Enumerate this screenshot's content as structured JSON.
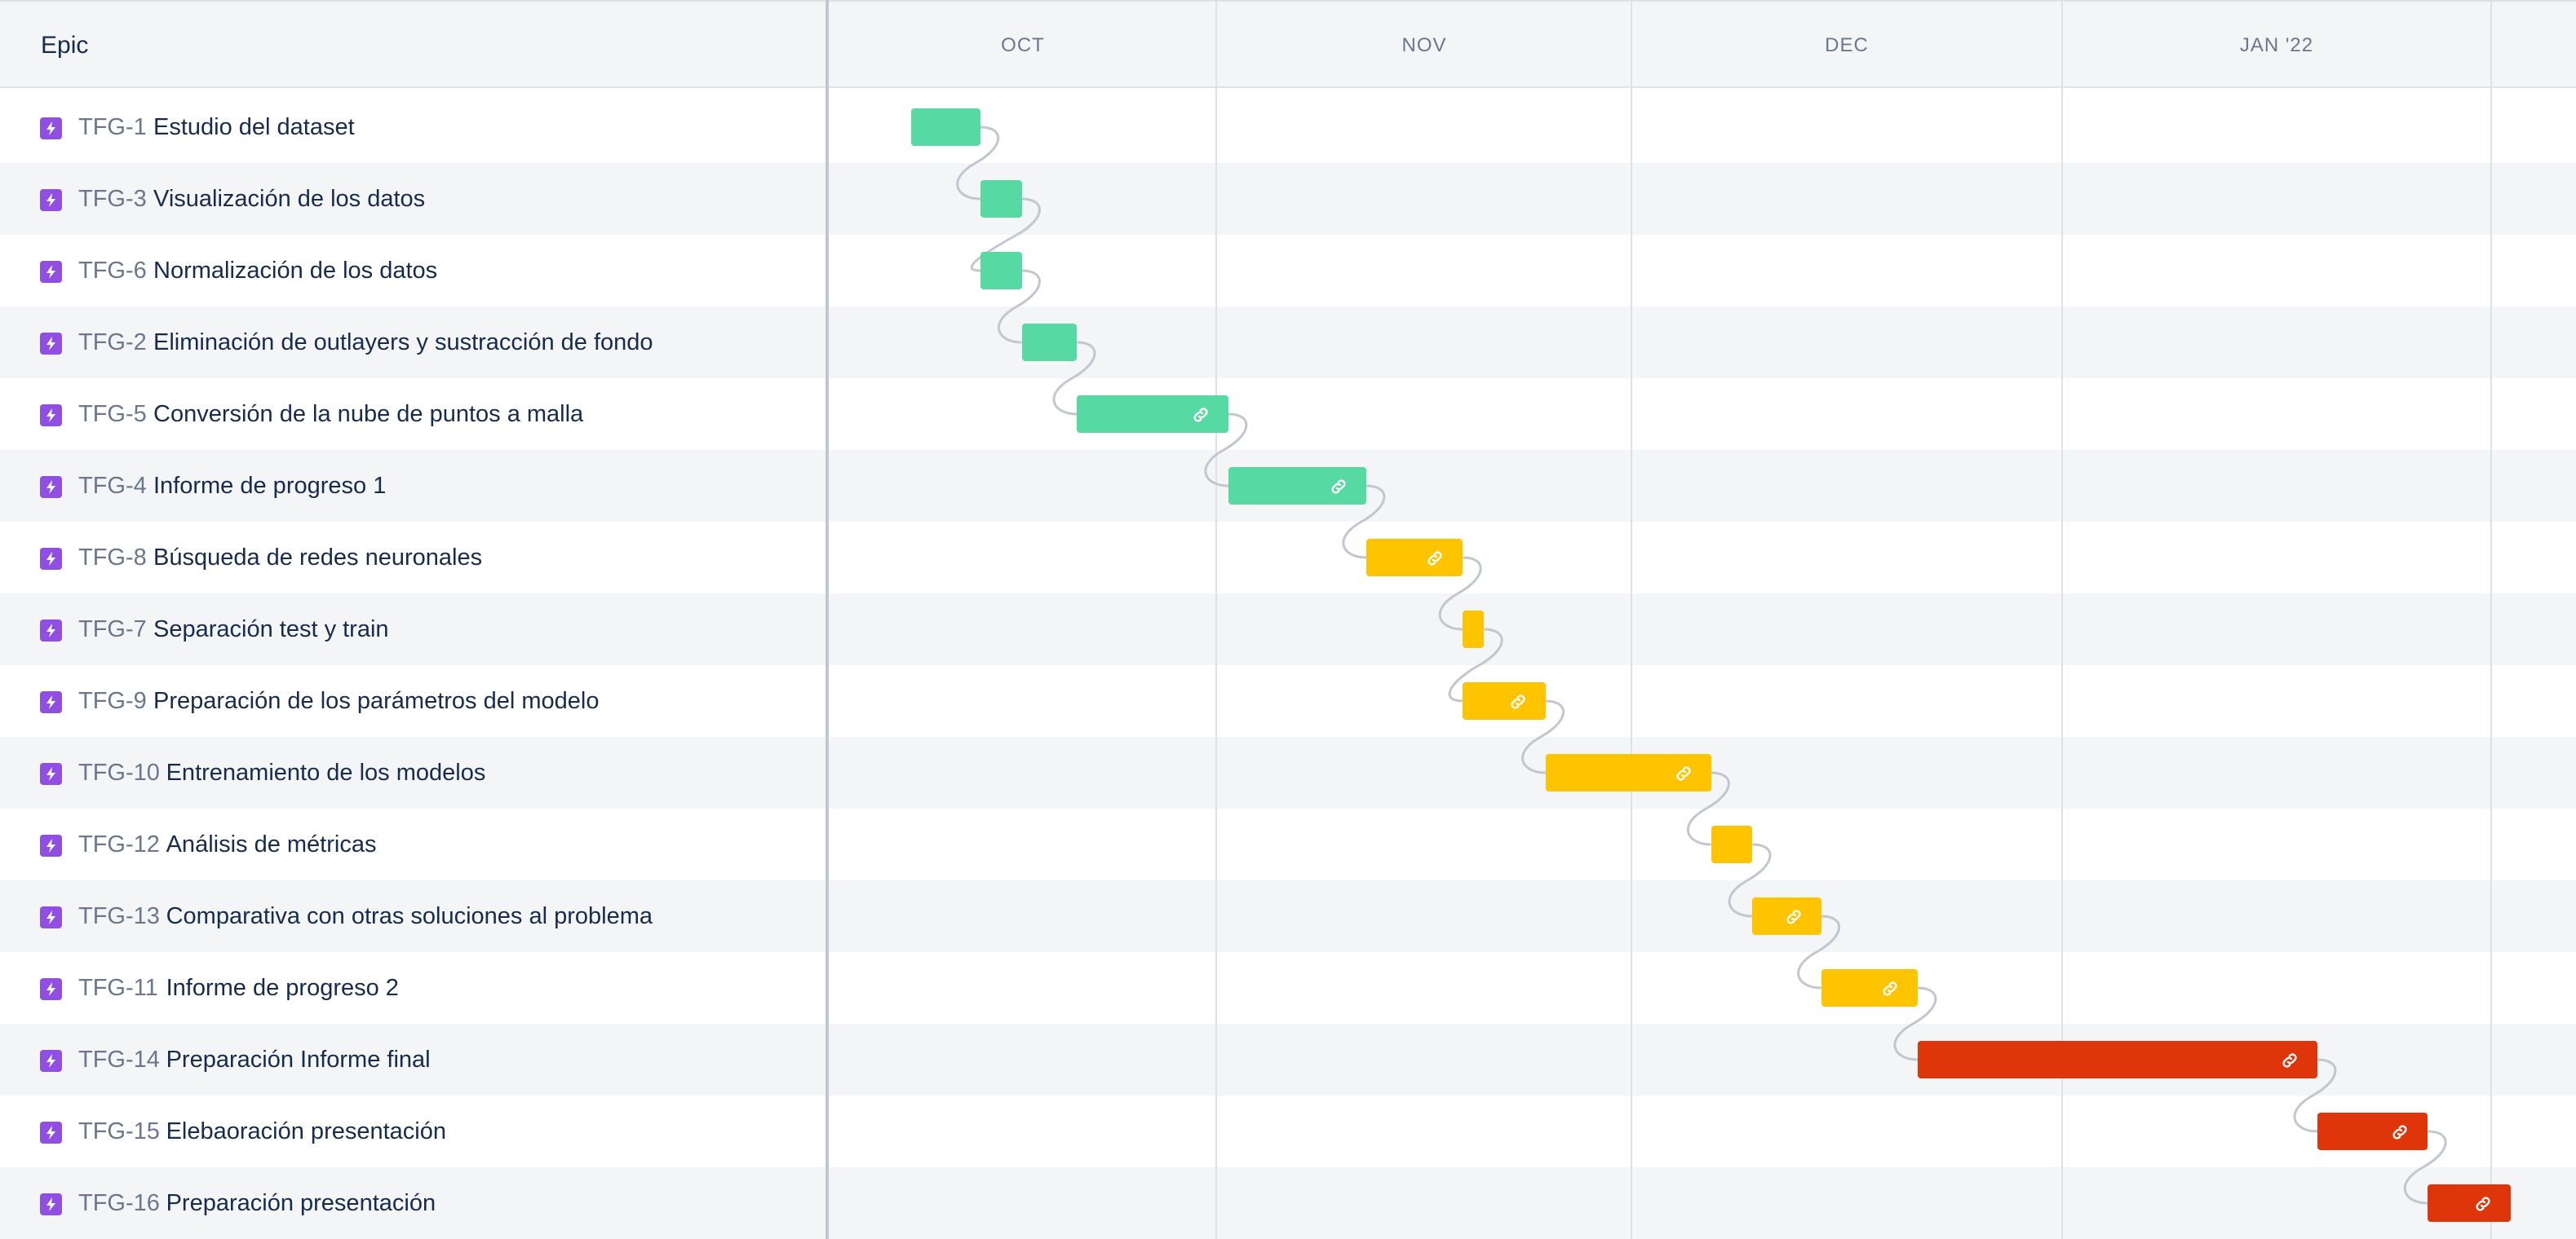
{
  "header": {
    "epic_label": "Epic",
    "months": [
      "OCT",
      "NOV",
      "DEC",
      "JAN '22"
    ]
  },
  "colors": {
    "green": "#57d9a3",
    "yellow": "#ffc400",
    "red": "#de350b",
    "epic_icon": "#904ee2",
    "dependency_line": "#c1c7d0"
  },
  "timeline": {
    "start": "2021-09-22",
    "end": "2022-02-01"
  },
  "epics": [
    {
      "key": "TFG-1",
      "title": "Estudio del dataset",
      "start": "2021-09-28",
      "end": "2021-10-03",
      "color": "green",
      "link": false,
      "icon": "epic-lightning-icon"
    },
    {
      "key": "TFG-3",
      "title": "Visualización de los datos",
      "start": "2021-10-03",
      "end": "2021-10-06",
      "color": "green",
      "link": false,
      "icon": "epic-lightning-icon"
    },
    {
      "key": "TFG-6",
      "title": "Normalización de los datos",
      "start": "2021-10-03",
      "end": "2021-10-06",
      "color": "green",
      "link": false,
      "icon": "epic-lightning-icon"
    },
    {
      "key": "TFG-2",
      "title": "Eliminación de outlayers y sustracción de fondo",
      "start": "2021-10-06",
      "end": "2021-10-10",
      "color": "green",
      "link": false,
      "icon": "epic-lightning-icon"
    },
    {
      "key": "TFG-5",
      "title": "Conversión de la nube de puntos a malla",
      "start": "2021-10-10",
      "end": "2021-10-21",
      "color": "green",
      "link": true,
      "icon": "epic-lightning-icon"
    },
    {
      "key": "TFG-4",
      "title": "Informe de progreso 1",
      "start": "2021-10-21",
      "end": "2021-10-31",
      "color": "green",
      "link": true,
      "icon": "epic-lightning-icon"
    },
    {
      "key": "TFG-8",
      "title": "Búsqueda de redes neuronales",
      "start": "2021-10-31",
      "end": "2021-11-07",
      "color": "yellow",
      "link": true,
      "icon": "epic-lightning-icon"
    },
    {
      "key": "TFG-7",
      "title": "Separación test y train",
      "start": "2021-11-07",
      "end": "2021-11-08",
      "color": "yellow",
      "link": false,
      "icon": "epic-lightning-icon"
    },
    {
      "key": "TFG-9",
      "title": "Preparación de los parámetros del modelo",
      "start": "2021-11-07",
      "end": "2021-11-13",
      "color": "yellow",
      "link": true,
      "icon": "epic-lightning-icon"
    },
    {
      "key": "TFG-10",
      "title": "Entrenamiento de los modelos",
      "start": "2021-11-13",
      "end": "2021-11-25",
      "color": "yellow",
      "link": true,
      "icon": "epic-lightning-icon"
    },
    {
      "key": "TFG-12",
      "title": "Análisis de métricas",
      "start": "2021-11-25",
      "end": "2021-11-28",
      "color": "yellow",
      "link": false,
      "icon": "epic-lightning-icon"
    },
    {
      "key": "TFG-13",
      "title": "Comparativa con otras soluciones al problema",
      "start": "2021-11-28",
      "end": "2021-12-03",
      "color": "yellow",
      "link": true,
      "icon": "epic-lightning-icon"
    },
    {
      "key": "TFG-11",
      "title": "Informe de progreso 2",
      "start": "2021-12-03",
      "end": "2021-12-10",
      "color": "yellow",
      "link": true,
      "icon": "epic-lightning-icon"
    },
    {
      "key": "TFG-14",
      "title": "Preparación Informe final",
      "start": "2021-12-10",
      "end": "2022-01-08",
      "color": "red",
      "link": true,
      "icon": "epic-lightning-icon"
    },
    {
      "key": "TFG-15",
      "title": "Elebaoración presentación",
      "start": "2022-01-08",
      "end": "2022-01-16",
      "color": "red",
      "link": true,
      "icon": "epic-lightning-icon"
    },
    {
      "key": "TFG-16",
      "title": "Preparación presentación",
      "start": "2022-01-16",
      "end": "2022-01-22",
      "color": "red",
      "link": true,
      "icon": "epic-lightning-icon"
    }
  ]
}
